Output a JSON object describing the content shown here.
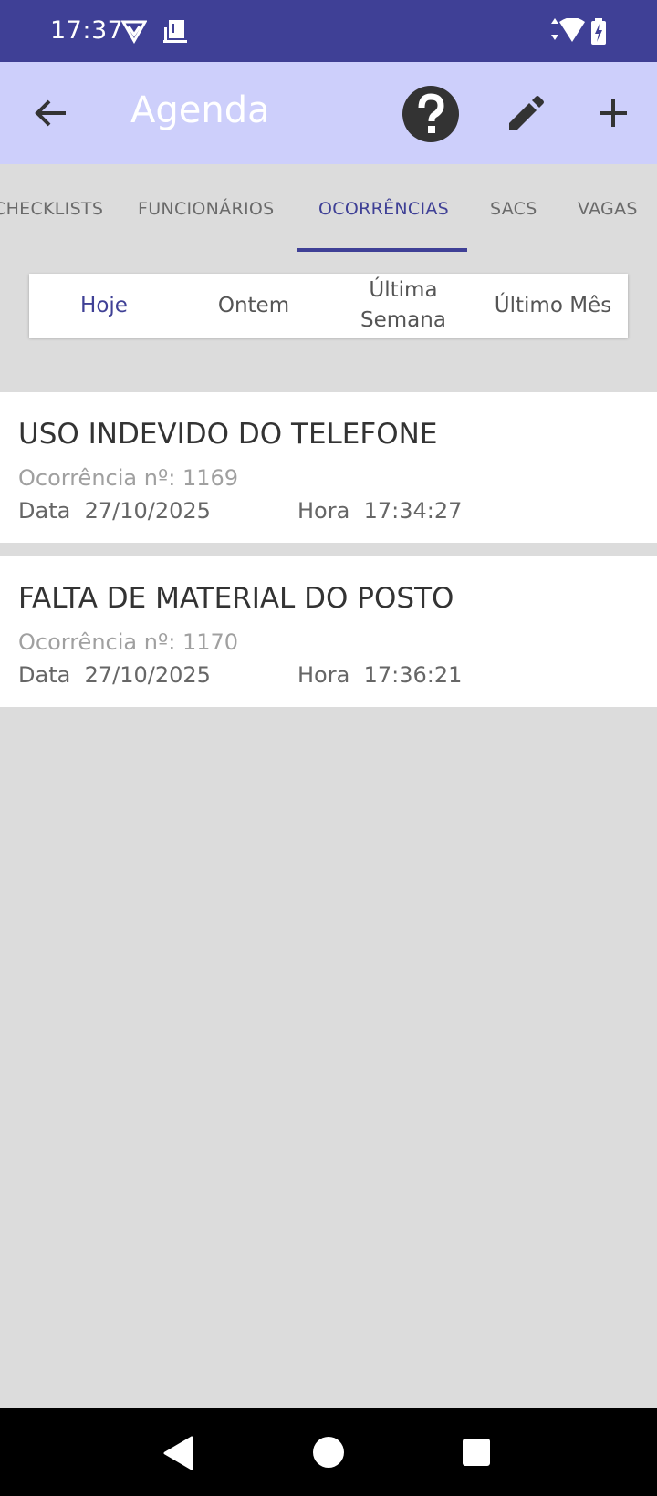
{
  "status_bar": {
    "time": "17:37",
    "icons": [
      "vpn-shield-icon",
      "device-icon",
      "wifi-icon",
      "battery-charging-icon"
    ]
  },
  "app_bar": {
    "title": "Agenda",
    "back_icon": "arrow-back-icon",
    "help_icon": "help-circle-icon",
    "edit_icon": "pencil-icon",
    "add_icon": "plus-icon"
  },
  "tabs": [
    {
      "label": "CHECKLISTS",
      "active": false
    },
    {
      "label": "FUNCIONÁRIOS",
      "active": false
    },
    {
      "label": "OCORRÊNCIAS",
      "active": true
    },
    {
      "label": "SACS",
      "active": false
    },
    {
      "label": "VAGAS",
      "active": false
    }
  ],
  "filters": [
    {
      "label": "Hoje",
      "active": true
    },
    {
      "label": "Ontem",
      "active": false
    },
    {
      "label": "Última Semana",
      "active": false
    },
    {
      "label": "Último Mês",
      "active": false
    }
  ],
  "occurrences": [
    {
      "title": "USO INDEVIDO DO TELEFONE",
      "number_label": "Ocorrência nº:",
      "number": "1169",
      "date_label": "Data",
      "date": "27/10/2025",
      "time_label": "Hora",
      "time": "17:34:27"
    },
    {
      "title": "FALTA DE MATERIAL DO POSTO",
      "number_label": "Ocorrência nº:",
      "number": "1170",
      "date_label": "Data",
      "date": "27/10/2025",
      "time_label": "Hora",
      "time": "17:36:21"
    }
  ],
  "colors": {
    "primary": "#3f4096",
    "app_bar_bg": "#cdcffb",
    "background": "#dcdcdc"
  }
}
